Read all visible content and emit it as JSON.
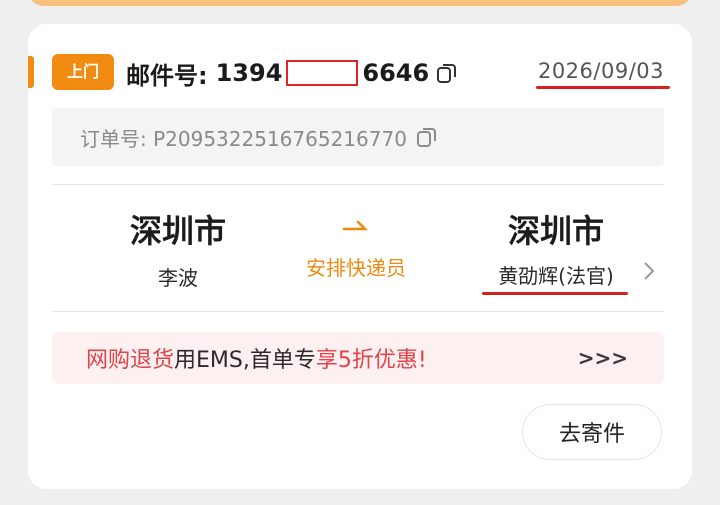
{
  "header": {
    "badge": "上门",
    "mail_label": "邮件号:",
    "mail_prefix": "1394",
    "mail_suffix": "6646",
    "date": "2026/09/03"
  },
  "order": {
    "label": "订单号: P2095322516765216770"
  },
  "route": {
    "from_city": "深圳市",
    "from_person": "李波",
    "status": "安排快递员",
    "to_city": "深圳市",
    "to_person": "黄劭辉(法官)"
  },
  "promo": {
    "part1": "网购退货",
    "part2": "用EMS,首单专",
    "part3": "享5折优惠!",
    "more": ">>>"
  },
  "actions": {
    "send_label": "去寄件"
  },
  "colors": {
    "accent": "#f28b12",
    "promo_red": "#e0444a",
    "annotation_red": "#d61f1f"
  }
}
